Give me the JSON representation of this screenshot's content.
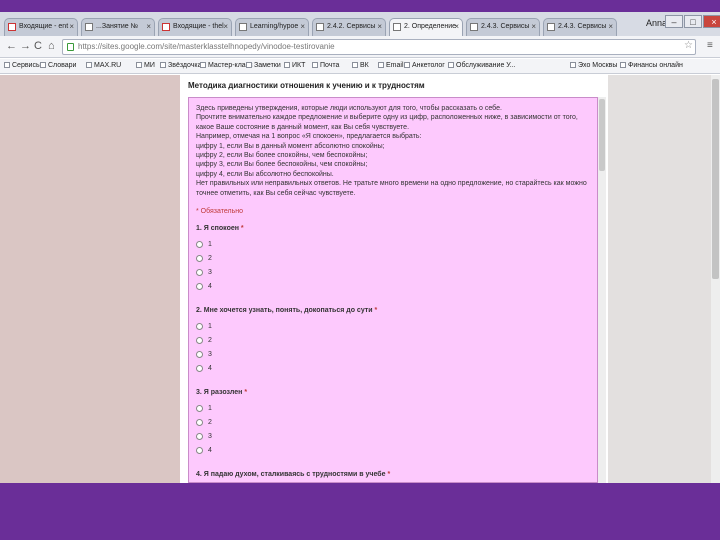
{
  "browser": {
    "tabs": [
      {
        "label": "Входящие - ent",
        "icon": "gmail-icon"
      },
      {
        "label": "...Занятие №",
        "icon": "page-icon"
      },
      {
        "label": "Входящие - thel",
        "icon": "gmail-icon"
      },
      {
        "label": "Learning/hypoe",
        "icon": "page-icon"
      },
      {
        "label": "2.4.2. Сервисы",
        "icon": "page-icon"
      },
      {
        "label": "2. Определение",
        "icon": "page-icon"
      },
      {
        "label": "2.4.3. Сервисы",
        "icon": "page-icon"
      },
      {
        "label": "2.4.3. Сервисы",
        "icon": "page-icon"
      }
    ],
    "active_tab_index": 5,
    "user_label": "Anna",
    "url": "https://sites.google.com/site/masterklasstelhnopedy/vinodoe-testirovanie",
    "bookmarks": [
      "Сервисы",
      "Словари",
      "МАХ.RU",
      "МИ",
      "Звёздочка",
      "Мастер-класс",
      "Заметки",
      "ИКТ",
      "Почта",
      "ВК",
      "Email",
      "Анкетолог",
      "Обслуживание У...",
      "Эхо Москвы",
      "Финансы онлайн"
    ]
  },
  "doc": {
    "title": "Методика диагностики отношения к учению и к трудностям",
    "instructions": [
      "Здесь приведены утверждения, которые люди используют для того, чтобы рассказать о себе.",
      "Прочтите внимательно каждое предложение и выберите одну из цифр, расположенных ниже, в зависимости от того,",
      "какое Ваше состояние в данный момент, как Вы себя чувствуете.",
      "Например, отмечая на 1 вопрос «Я спокоен», предлагается выбрать:",
      "цифру 1, если Вы в данный момент абсолютно спокойны;",
      "цифру 2, если Вы более спокойны, чем беспокойны;",
      "цифру 3, если Вы более беспокойны, чем спокойны;",
      "цифру 4, если Вы абсолютно беспокойны.",
      "Нет правильных или неправильных ответов. Не тратьте много времени на одно предложение, но старайтесь как можно",
      "точнее отметить, как Вы себя сейчас чувствуете."
    ],
    "required_note": "* Обязательно",
    "questions": [
      {
        "title": "1. Я спокоен",
        "options": [
          "1",
          "2",
          "3",
          "4"
        ]
      },
      {
        "title": "2. Мне хочется узнать, понять, докопаться до сути",
        "options": [
          "1",
          "2",
          "3",
          "4"
        ]
      },
      {
        "title": "3. Я разозлен",
        "options": [
          "1",
          "2",
          "3",
          "4"
        ]
      },
      {
        "title": "4. Я падаю духом, сталкиваясь с трудностями в учебе",
        "options": []
      }
    ]
  }
}
